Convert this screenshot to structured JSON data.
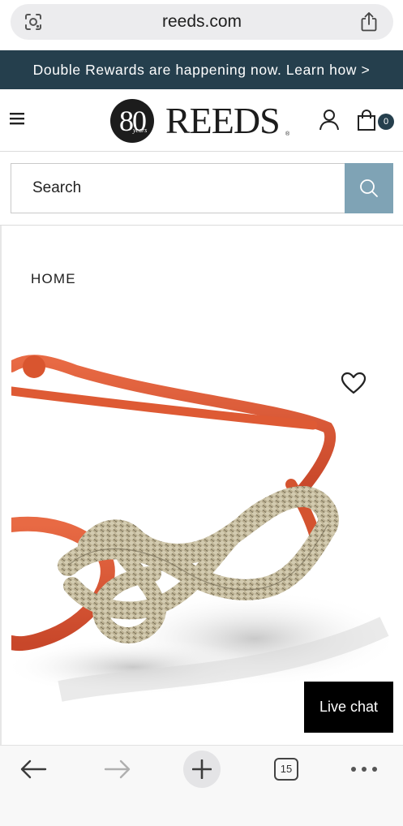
{
  "browser": {
    "url": "reeds.com",
    "lens_icon": "google-lens-icon",
    "share_icon": "share-icon"
  },
  "promo": {
    "text": "Double Rewards are happening now. Learn how >"
  },
  "header": {
    "menu_icon": "hamburger-menu-icon",
    "logo_badge": "80",
    "logo_badge_sub": "years",
    "logo_text": "REEDS",
    "logo_tm": "®",
    "account_icon": "user-icon",
    "bag_icon": "shopping-bag-icon",
    "bag_count": "0"
  },
  "search": {
    "placeholder": "Search",
    "button_icon": "search-icon"
  },
  "breadcrumb": {
    "home": "HOME"
  },
  "product": {
    "wishlist_icon": "heart-icon"
  },
  "live_chat": {
    "label": "Live chat"
  },
  "bottom_nav": {
    "back_icon": "back-arrow-icon",
    "forward_icon": "forward-arrow-icon",
    "new_tab_icon": "plus-icon",
    "tab_count": "15",
    "more_icon": "more-dots-icon"
  },
  "colors": {
    "promo_bg": "#253f4d",
    "search_button": "#7fa3b5",
    "cord": "#d8502c",
    "silver": "#b7ab8c",
    "live_chat_bg": "#000000"
  }
}
